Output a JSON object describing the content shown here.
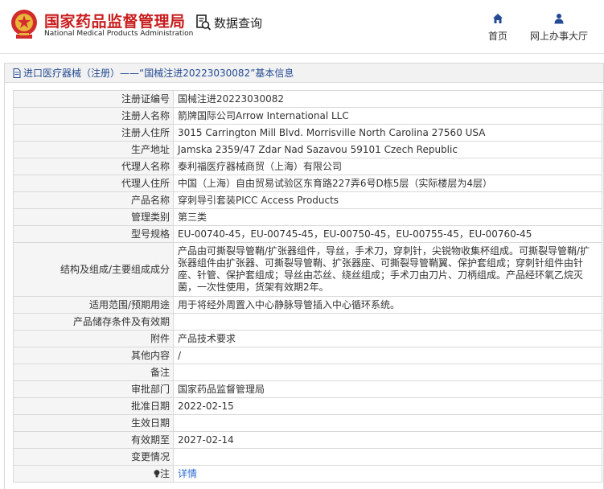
{
  "header": {
    "org_cn": "国家药品监督管理局",
    "org_en": "National Medical Products Administration",
    "query_label": "数据查询",
    "nav": [
      {
        "label": "首页",
        "icon": "home-icon"
      },
      {
        "label": "网上办事大厅",
        "icon": "person-icon"
      }
    ]
  },
  "breadcrumb": {
    "text": "进口医疗器械（注册）——“国械注进20223030082”基本信息",
    "icon": "document-icon"
  },
  "record": {
    "rows": [
      {
        "label": "注册证编号",
        "value": "国械注进20223030082"
      },
      {
        "label": "注册人名称",
        "value": "箭牌国际公司Arrow International LLC"
      },
      {
        "label": "注册人住所",
        "value": "3015 Carrington Mill Blvd. Morrisville North Carolina 27560 USA"
      },
      {
        "label": "生产地址",
        "value": "Jamska 2359/47 Zdar Nad Sazavou 59101 Czech Republic"
      },
      {
        "label": "代理人名称",
        "value": "泰利福医疗器械商贸（上海）有限公司"
      },
      {
        "label": "代理人住所",
        "value": "中国（上海）自由贸易试验区东育路227弄6号D栋5层（实际楼层为4层）"
      },
      {
        "label": "产品名称",
        "value": "穿刺导引套装PICC Access Products"
      },
      {
        "label": "管理类别",
        "value": "第三类"
      },
      {
        "label": "型号规格",
        "value": "EU-00740-45，EU-00745-45，EU-00750-45，EU-00755-45，EU-00760-45"
      },
      {
        "label": "结构及组成/主要组成成分",
        "value": "产品由可撕裂导管鞘/扩张器组件，导丝，手术刀，穿刺针，尖锐物收集杯组成。可撕裂导管鞘/扩张器组件由扩张器、可撕裂导管鞘、扩张器座、可撕裂导管鞘翼、保护套组成；穿刺针组件由针座、针管、保护套组成；导丝由芯丝、绕丝组成；手术刀由刀片、刀柄组成。产品经环氧乙烷灭菌，一次性使用，货架有效期2年。"
      },
      {
        "label": "适用范围/预期用途",
        "value": "用于将经外周置入中心静脉导管插入中心循环系统。"
      },
      {
        "label": "产品储存条件及有效期",
        "value": ""
      },
      {
        "label": "附件",
        "value": "产品技术要求"
      },
      {
        "label": "其他内容",
        "value": "/"
      },
      {
        "label": "备注",
        "value": ""
      },
      {
        "label": "审批部门",
        "value": "国家药品监督管理局"
      },
      {
        "label": "批准日期",
        "value": "2022-02-15"
      },
      {
        "label": "生效日期",
        "value": ""
      },
      {
        "label": "有效期至",
        "value": "2027-02-14"
      },
      {
        "label": "变更情况",
        "value": ""
      },
      {
        "label": "注",
        "value": "详情"
      }
    ]
  }
}
